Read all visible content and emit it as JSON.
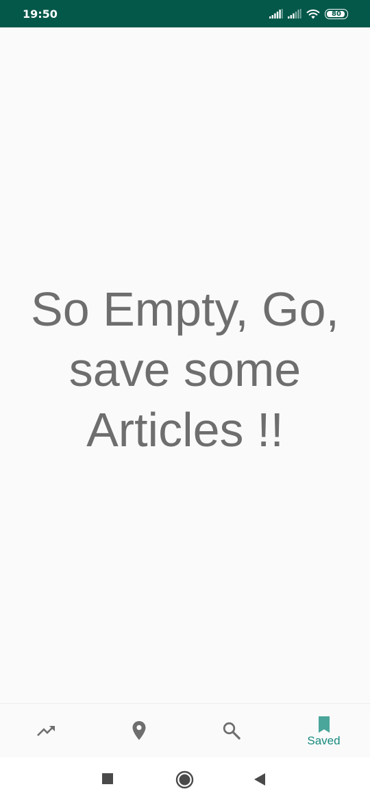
{
  "status_bar": {
    "time": "19:50",
    "battery_level": "80",
    "background_color": "#04584a",
    "icons": [
      "signal-icon",
      "signal-icon",
      "wifi-icon",
      "battery-icon"
    ]
  },
  "main": {
    "empty_message": "So Empty, Go, save some Articles !!",
    "text_color": "#6e6e6e"
  },
  "bottom_nav": {
    "active_color": "#168a7e",
    "inactive_color": "#6e6e6e",
    "items": [
      {
        "icon": "trending-up-icon",
        "label": ""
      },
      {
        "icon": "location-pin-icon",
        "label": ""
      },
      {
        "icon": "search-icon",
        "label": ""
      },
      {
        "icon": "bookmark-icon",
        "label": "Saved",
        "active": true
      }
    ]
  },
  "system_nav": {
    "buttons": [
      "recents-square-icon",
      "home-circle-icon",
      "back-triangle-icon"
    ]
  }
}
